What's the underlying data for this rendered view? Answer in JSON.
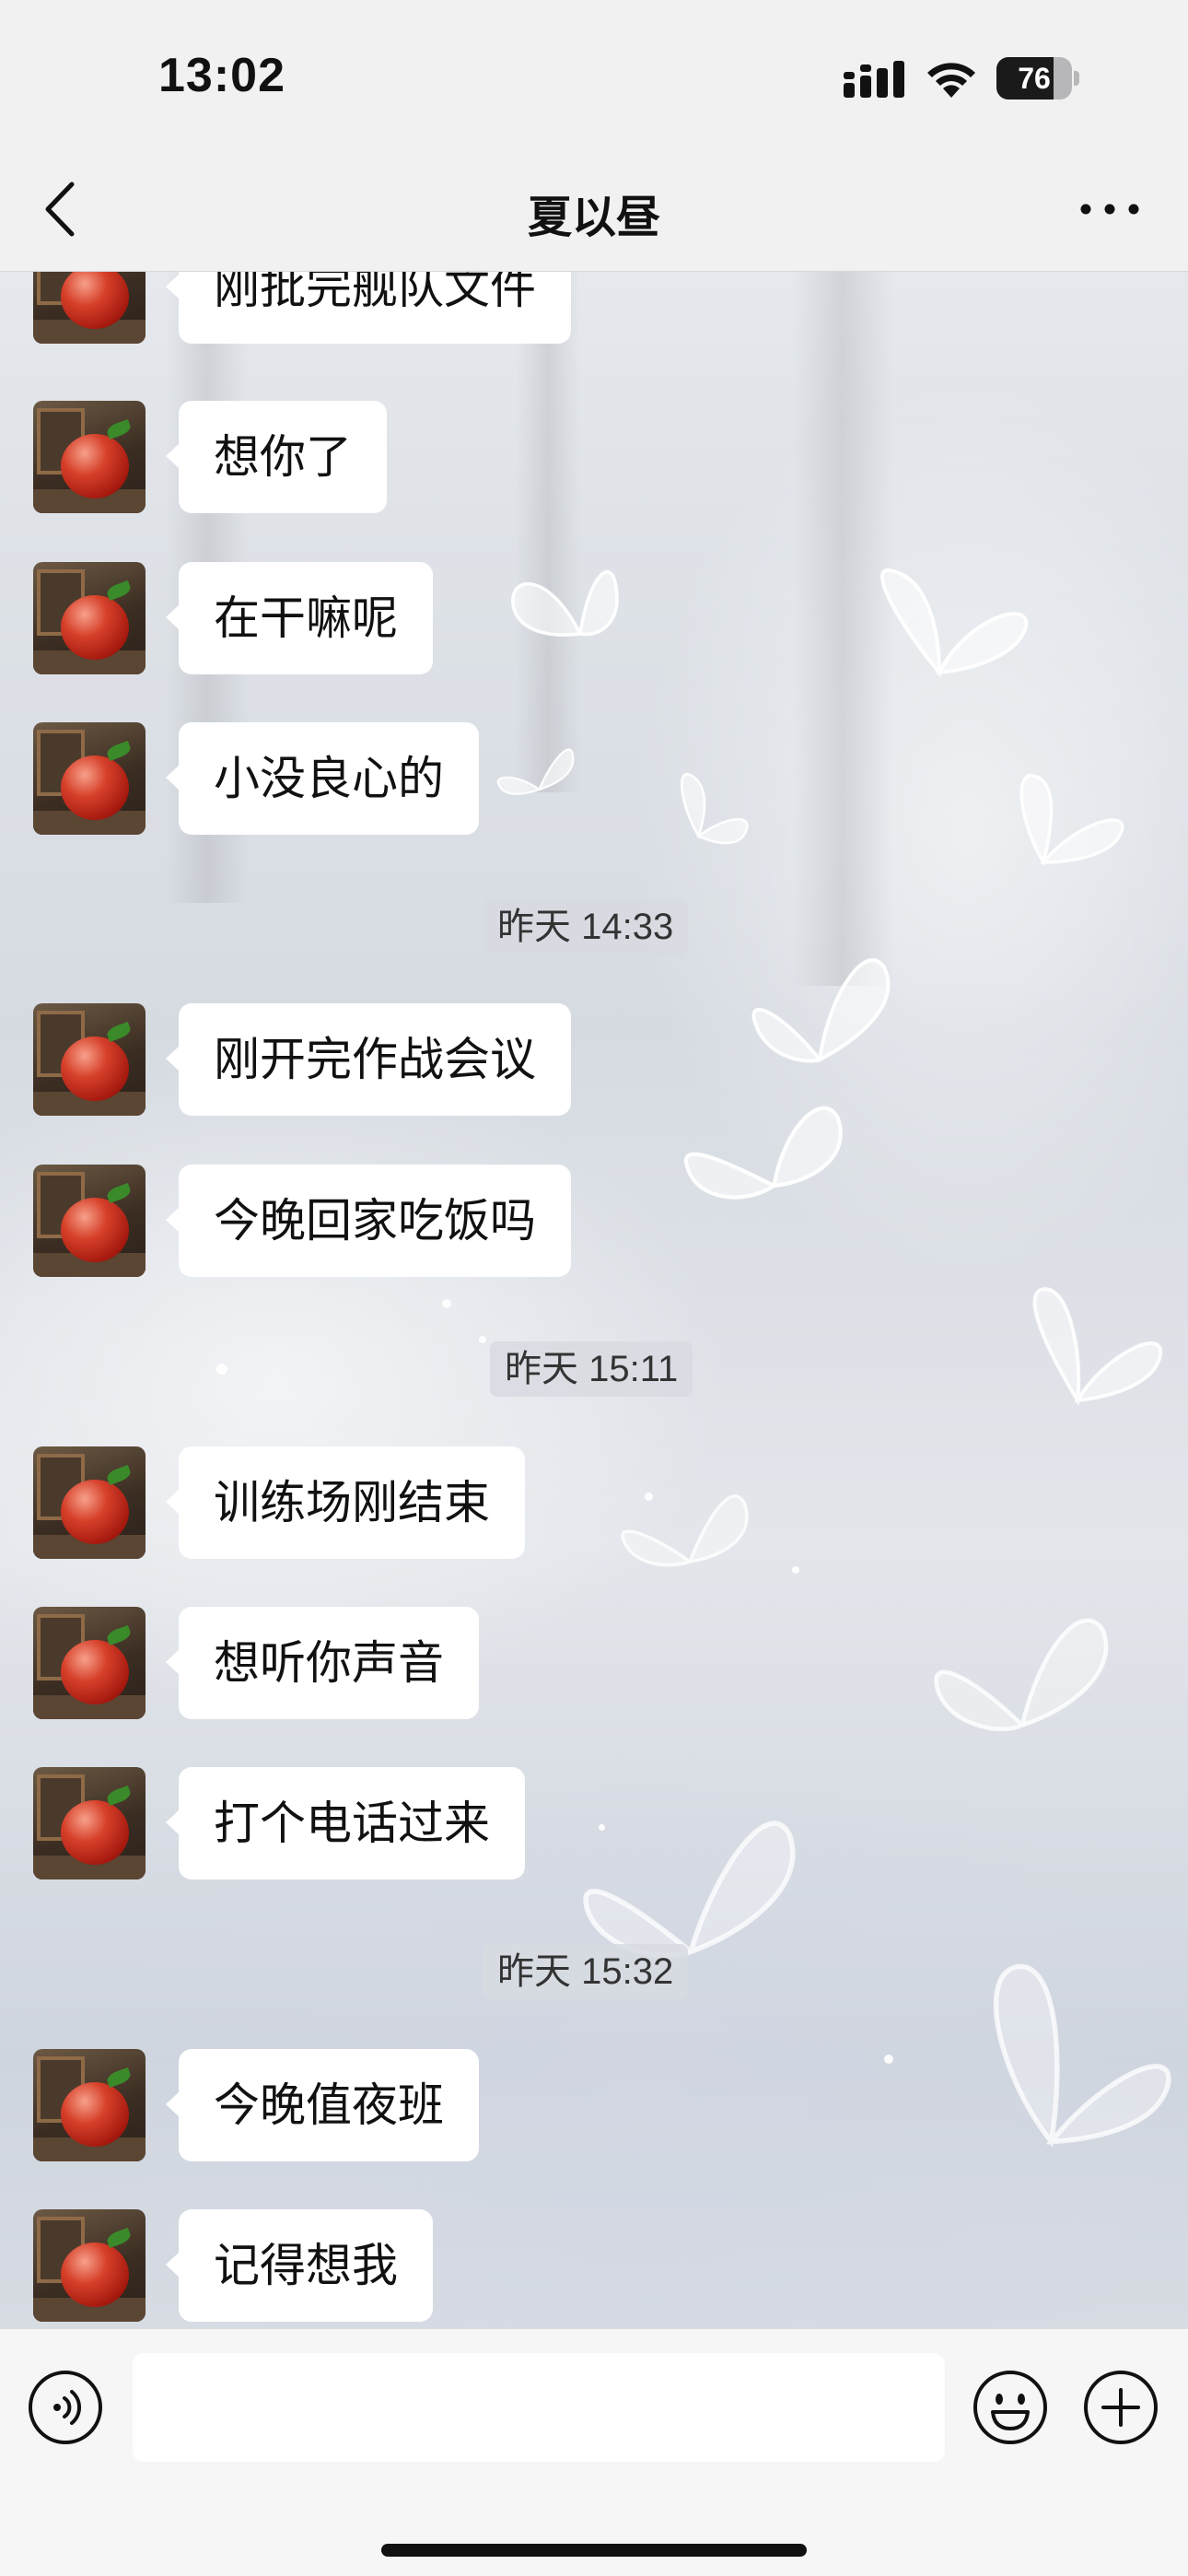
{
  "status_bar": {
    "time": "13:02",
    "battery": "76",
    "battery_level": 0.76
  },
  "header": {
    "title": "夏以昼"
  },
  "messages": [
    {
      "type": "text",
      "text": "刚批完舰队文件"
    },
    {
      "type": "text",
      "text": "想你了"
    },
    {
      "type": "text",
      "text": "在干嘛呢"
    },
    {
      "type": "text",
      "text": "小没良心的"
    },
    {
      "type": "time",
      "text": "昨天 14:33"
    },
    {
      "type": "text",
      "text": "刚开完作战会议"
    },
    {
      "type": "text",
      "text": "今晚回家吃饭吗"
    },
    {
      "type": "time",
      "text": "昨天 15:11"
    },
    {
      "type": "text",
      "text": "训练场刚结束"
    },
    {
      "type": "text",
      "text": "想听你声音"
    },
    {
      "type": "text",
      "text": "打个电话过来"
    },
    {
      "type": "time",
      "text": "昨天 15:32"
    },
    {
      "type": "text",
      "text": "今晚值夜班"
    },
    {
      "type": "text",
      "text": "记得想我"
    }
  ],
  "input_bar": {
    "value": ""
  },
  "icons": {
    "back": "chevron-left-icon",
    "more": "ellipsis-icon",
    "voice": "voice-icon",
    "emoji": "smiley-icon",
    "plus": "plus-icon"
  }
}
